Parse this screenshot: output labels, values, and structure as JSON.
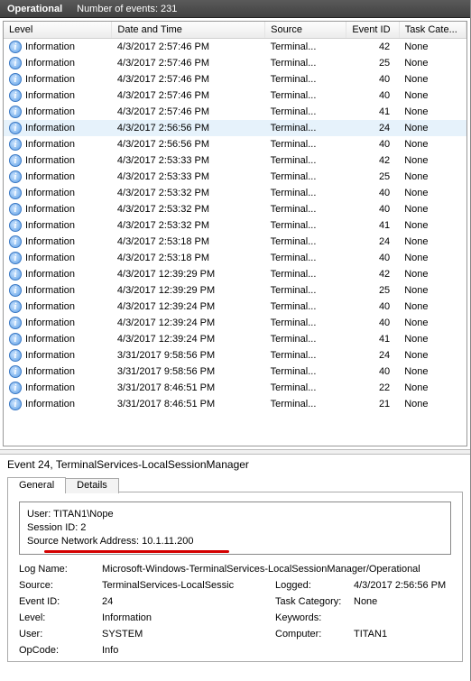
{
  "header": {
    "title": "Operational",
    "events_label": "Number of events: 231"
  },
  "columns": {
    "level": "Level",
    "date": "Date and Time",
    "source": "Source",
    "evid": "Event ID",
    "cat": "Task Cate..."
  },
  "level_text": "Information",
  "source_text": "Terminal...",
  "cat_none": "None",
  "selected_index": 5,
  "events": [
    {
      "date": "4/3/2017 2:57:46 PM",
      "id": 42
    },
    {
      "date": "4/3/2017 2:57:46 PM",
      "id": 25
    },
    {
      "date": "4/3/2017 2:57:46 PM",
      "id": 40
    },
    {
      "date": "4/3/2017 2:57:46 PM",
      "id": 40
    },
    {
      "date": "4/3/2017 2:57:46 PM",
      "id": 41
    },
    {
      "date": "4/3/2017 2:56:56 PM",
      "id": 24
    },
    {
      "date": "4/3/2017 2:56:56 PM",
      "id": 40
    },
    {
      "date": "4/3/2017 2:53:33 PM",
      "id": 42
    },
    {
      "date": "4/3/2017 2:53:33 PM",
      "id": 25
    },
    {
      "date": "4/3/2017 2:53:32 PM",
      "id": 40
    },
    {
      "date": "4/3/2017 2:53:32 PM",
      "id": 40
    },
    {
      "date": "4/3/2017 2:53:32 PM",
      "id": 41
    },
    {
      "date": "4/3/2017 2:53:18 PM",
      "id": 24
    },
    {
      "date": "4/3/2017 2:53:18 PM",
      "id": 40
    },
    {
      "date": "4/3/2017 12:39:29 PM",
      "id": 42
    },
    {
      "date": "4/3/2017 12:39:29 PM",
      "id": 25
    },
    {
      "date": "4/3/2017 12:39:24 PM",
      "id": 40
    },
    {
      "date": "4/3/2017 12:39:24 PM",
      "id": 40
    },
    {
      "date": "4/3/2017 12:39:24 PM",
      "id": 41
    },
    {
      "date": "3/31/2017 9:58:56 PM",
      "id": 24
    },
    {
      "date": "3/31/2017 9:58:56 PM",
      "id": 40
    },
    {
      "date": "3/31/2017 8:46:51 PM",
      "id": 22
    },
    {
      "date": "3/31/2017 8:46:51 PM",
      "id": 21
    }
  ],
  "detail": {
    "title": "Event 24, TerminalServices-LocalSessionManager",
    "tabs": {
      "general": "General",
      "details": "Details"
    },
    "msg": {
      "user": "User: TITAN1\\Nope",
      "session": "Session ID: 2",
      "source_addr": "Source Network Address: 10.1.11.200"
    },
    "props": {
      "logname_lbl": "Log Name:",
      "logname_val": "Microsoft-Windows-TerminalServices-LocalSessionManager/Operational",
      "source_lbl": "Source:",
      "source_val": "TerminalServices-LocalSessic",
      "logged_lbl": "Logged:",
      "logged_val": "4/3/2017 2:56:56 PM",
      "eventid_lbl": "Event ID:",
      "eventid_val": "24",
      "taskcat_lbl": "Task Category:",
      "taskcat_val": "None",
      "level_lbl": "Level:",
      "level_val": "Information",
      "keywords_lbl": "Keywords:",
      "keywords_val": "",
      "user_lbl": "User:",
      "user_val": "SYSTEM",
      "computer_lbl": "Computer:",
      "computer_val": "TITAN1",
      "opcode_lbl": "OpCode:",
      "opcode_val": "Info"
    }
  }
}
